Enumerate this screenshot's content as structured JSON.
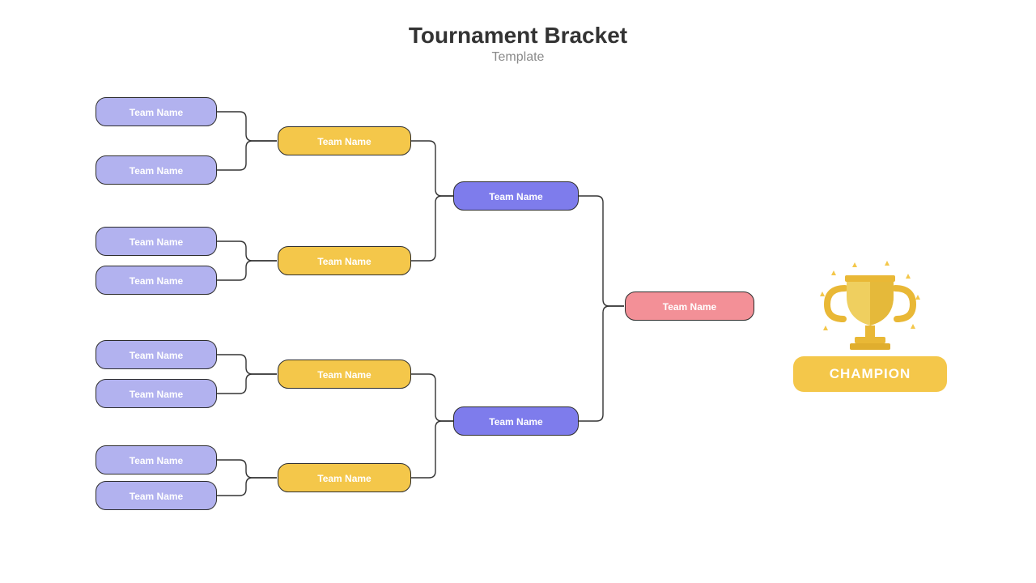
{
  "header": {
    "title": "Tournament Bracket",
    "subtitle": "Template"
  },
  "rounds": {
    "r1": [
      "Team Name",
      "Team Name",
      "Team Name",
      "Team Name",
      "Team Name",
      "Team Name",
      "Team Name",
      "Team Name"
    ],
    "r2": [
      "Team Name",
      "Team Name",
      "Team Name",
      "Team Name"
    ],
    "r3": [
      "Team Name",
      "Team Name"
    ],
    "r4": [
      "Team Name"
    ]
  },
  "champion_label": "CHAMPION",
  "colors": {
    "purple": "#b2b2ef",
    "yellow": "#f4c74a",
    "violet": "#7e7cec",
    "pink": "#f39097",
    "outline": "#2d2d2d"
  }
}
